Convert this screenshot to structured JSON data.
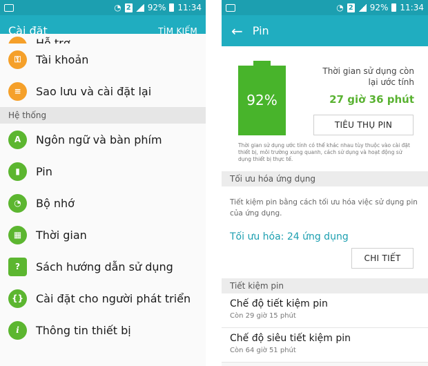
{
  "status": {
    "battery": "92%",
    "time": "11:34",
    "sim": "2"
  },
  "left": {
    "title": "Cài đặt",
    "search": "TÌM KIẾM",
    "items_top": [
      {
        "label": "Hỗ trợ",
        "icon": "support-icon"
      },
      {
        "label": "Tài khoản",
        "icon": "key-icon"
      },
      {
        "label": "Sao lưu và cài đặt lại",
        "icon": "backup-icon"
      }
    ],
    "section": "Hệ thống",
    "items_system": [
      {
        "label": "Ngôn ngữ và bàn phím",
        "icon": "language-icon",
        "glyph": "A"
      },
      {
        "label": "Pin",
        "icon": "battery-icon",
        "glyph": "▮"
      },
      {
        "label": "Bộ nhớ",
        "icon": "memory-icon",
        "glyph": "◔"
      },
      {
        "label": "Thời gian",
        "icon": "calendar-icon",
        "glyph": "▦"
      },
      {
        "label": "Sách hướng dẫn sử dụng",
        "icon": "manual-icon",
        "glyph": "?"
      },
      {
        "label": "Cài đặt cho người phát triển",
        "icon": "developer-icon",
        "glyph": "{}"
      },
      {
        "label": "Thông tin thiết bị",
        "icon": "info-icon",
        "glyph": "i"
      }
    ]
  },
  "right": {
    "title": "Pin",
    "battery_pct": "92%",
    "remaining_label": "Thời gian sử dụng còn lại ước tính",
    "remaining_value": "27 giờ 36 phút",
    "usage_button": "TIÊU THỤ PIN",
    "note": "Thời gian sử dụng ước tính có thể khác nhau tùy thuộc vào cài đặt thiết bị, môi trường xung quanh, cách sử dụng và hoạt động sử dụng thiết bị thực tế.",
    "opt_section": "Tối ưu hóa ứng dụng",
    "opt_desc": "Tiết kiệm pin bằng cách tối ưu hóa việc sử dụng pin của ứng dụng.",
    "opt_value": "Tối ưu hóa: 24 ứng dụng",
    "detail_button": "CHI TIẾT",
    "save_section": "Tiết kiệm pin",
    "save_items": [
      {
        "title": "Chế độ tiết kiệm pin",
        "sub": "Còn 29 giờ 15 phút"
      },
      {
        "title": "Chế độ siêu tiết kiệm pin",
        "sub": "Còn 64 giờ 51 phút"
      }
    ]
  },
  "colors": {
    "accent": "#20adc0",
    "status": "#1c9fb0",
    "battery_green": "#48b42b",
    "orange": "#f5a02a",
    "green": "#5cb630"
  }
}
